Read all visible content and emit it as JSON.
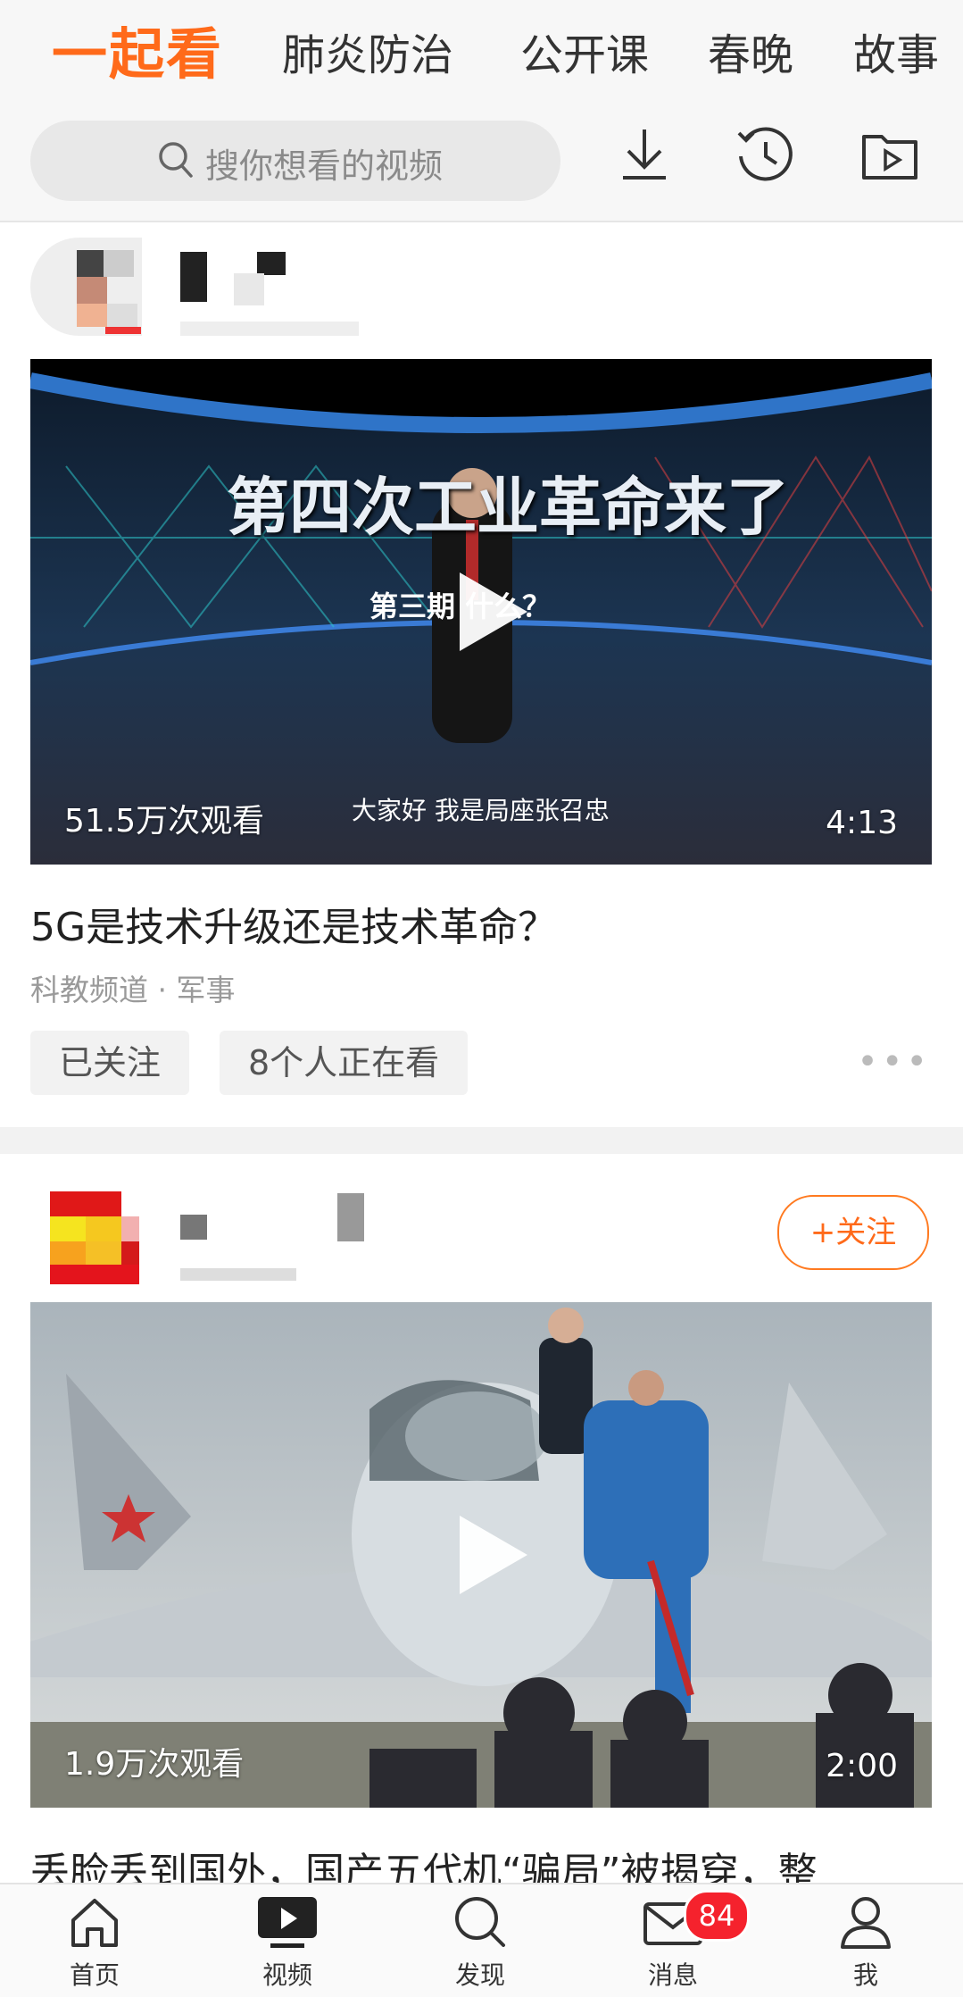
{
  "header": {
    "brand": "一起看",
    "tabs": [
      "肺炎防治",
      "公开课",
      "春晚",
      "故事"
    ],
    "search_placeholder": "搜你想看的视频"
  },
  "feed": [
    {
      "thumb_views": "51.5万次观看",
      "thumb_caption": "大家好 我是局座张召忠",
      "thumb_overlay_title": "第四次工业革命来了",
      "thumb_overlay_sub": "第三期 什么？",
      "duration": "4:13",
      "title": "5G是技术升级还是技术革命？",
      "meta": "科教频道 · 军事",
      "followed_label": "已关注",
      "watching_label": "8个人正在看",
      "more": "•••"
    },
    {
      "follow_label": "+关注",
      "thumb_views": "1.9万次观看",
      "duration": "2:00",
      "title": "丢脸丢到国外，国产五代机“骗局”被揭穿，整"
    }
  ],
  "bottom_nav": [
    {
      "label": "首页",
      "icon": "home-icon"
    },
    {
      "label": "视频",
      "icon": "video-icon"
    },
    {
      "label": "发现",
      "icon": "discover-icon"
    },
    {
      "label": "消息",
      "icon": "mail-icon",
      "badge": "84"
    },
    {
      "label": "我",
      "icon": "profile-icon"
    }
  ],
  "colors": {
    "accent": "#ff6a1a",
    "badge": "#f5222d"
  }
}
